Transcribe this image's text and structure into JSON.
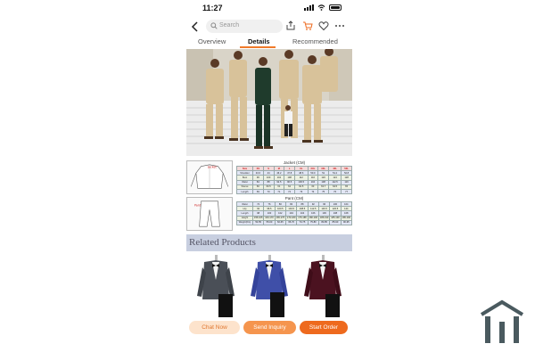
{
  "status": {
    "time": "11:27"
  },
  "search": {
    "placeholder": "Search"
  },
  "tabs": [
    "Overview",
    "Details",
    "Recommended"
  ],
  "active_tab": "Details",
  "size_chart": {
    "jacket_title": "Jacket (CM)",
    "pant_title": "Pant (CM)",
    "jacket_label": "Jacket",
    "pant_label": "Pant",
    "jacket_headers": [
      "Size",
      "XS",
      "S",
      "M",
      "L",
      "XL",
      "2XL",
      "3XL",
      "4XL",
      "5XL"
    ],
    "jacket_rows": [
      {
        "label": "Shoulder",
        "values": [
          "43.6",
          "44",
          "46.2",
          "47.8",
          "48.6",
          "50.0",
          "51",
          "51.2",
          "52.8"
        ]
      },
      {
        "label": "Bust",
        "values": [
          "96",
          "100",
          "104",
          "108",
          "112",
          "116",
          "120",
          "124",
          "128"
        ]
      },
      {
        "label": "Waist",
        "values": [
          "84",
          "88",
          "92.5",
          "96.5",
          "100.5",
          "104",
          "108",
          "112.5",
          "116"
        ]
      },
      {
        "label": "Sleeve",
        "values": [
          "60",
          "60.5",
          "61",
          "62",
          "62.5",
          "63",
          "63.7",
          "64.5",
          "65"
        ]
      },
      {
        "label": "Length",
        "values": [
          "69",
          "70",
          "71",
          "72",
          "73",
          "74",
          "75",
          "76",
          "77"
        ]
      }
    ],
    "pant_rows": [
      {
        "label": "Waist",
        "values": [
          "72",
          "76",
          "80",
          "84",
          "88",
          "92",
          "96",
          "100",
          "104"
        ]
      },
      {
        "label": "Hip",
        "values": [
          "92",
          "96.5",
          "100.5",
          "104.5",
          "108.5",
          "112.5",
          "116.5",
          "120.5",
          "124"
        ]
      },
      {
        "label": "Length",
        "values": [
          "98",
          "100",
          "102",
          "104",
          "104",
          "106",
          "106",
          "108",
          "108"
        ]
      },
      {
        "label": "Height",
        "values": [
          "155-165",
          "160-170",
          "165-175",
          "170-180",
          "175-185",
          "180-190",
          "185-190",
          "185-190",
          "185-190"
        ]
      },
      {
        "label": "Weight(KG)",
        "values": [
          "50-55",
          "55-60",
          "60-65",
          "65-70",
          "70-75",
          "75-80",
          "80-85",
          "85-90",
          "90-95"
        ]
      }
    ]
  },
  "related": {
    "title": "Related Products"
  },
  "actions": {
    "chat": "Chat Now",
    "inquiry": "Send Inquiry",
    "order": "Start Order"
  },
  "colors": {
    "accent": "#ee6a1e",
    "accent_light": "#fde3cc",
    "related_bar": "#c8cfe0"
  }
}
